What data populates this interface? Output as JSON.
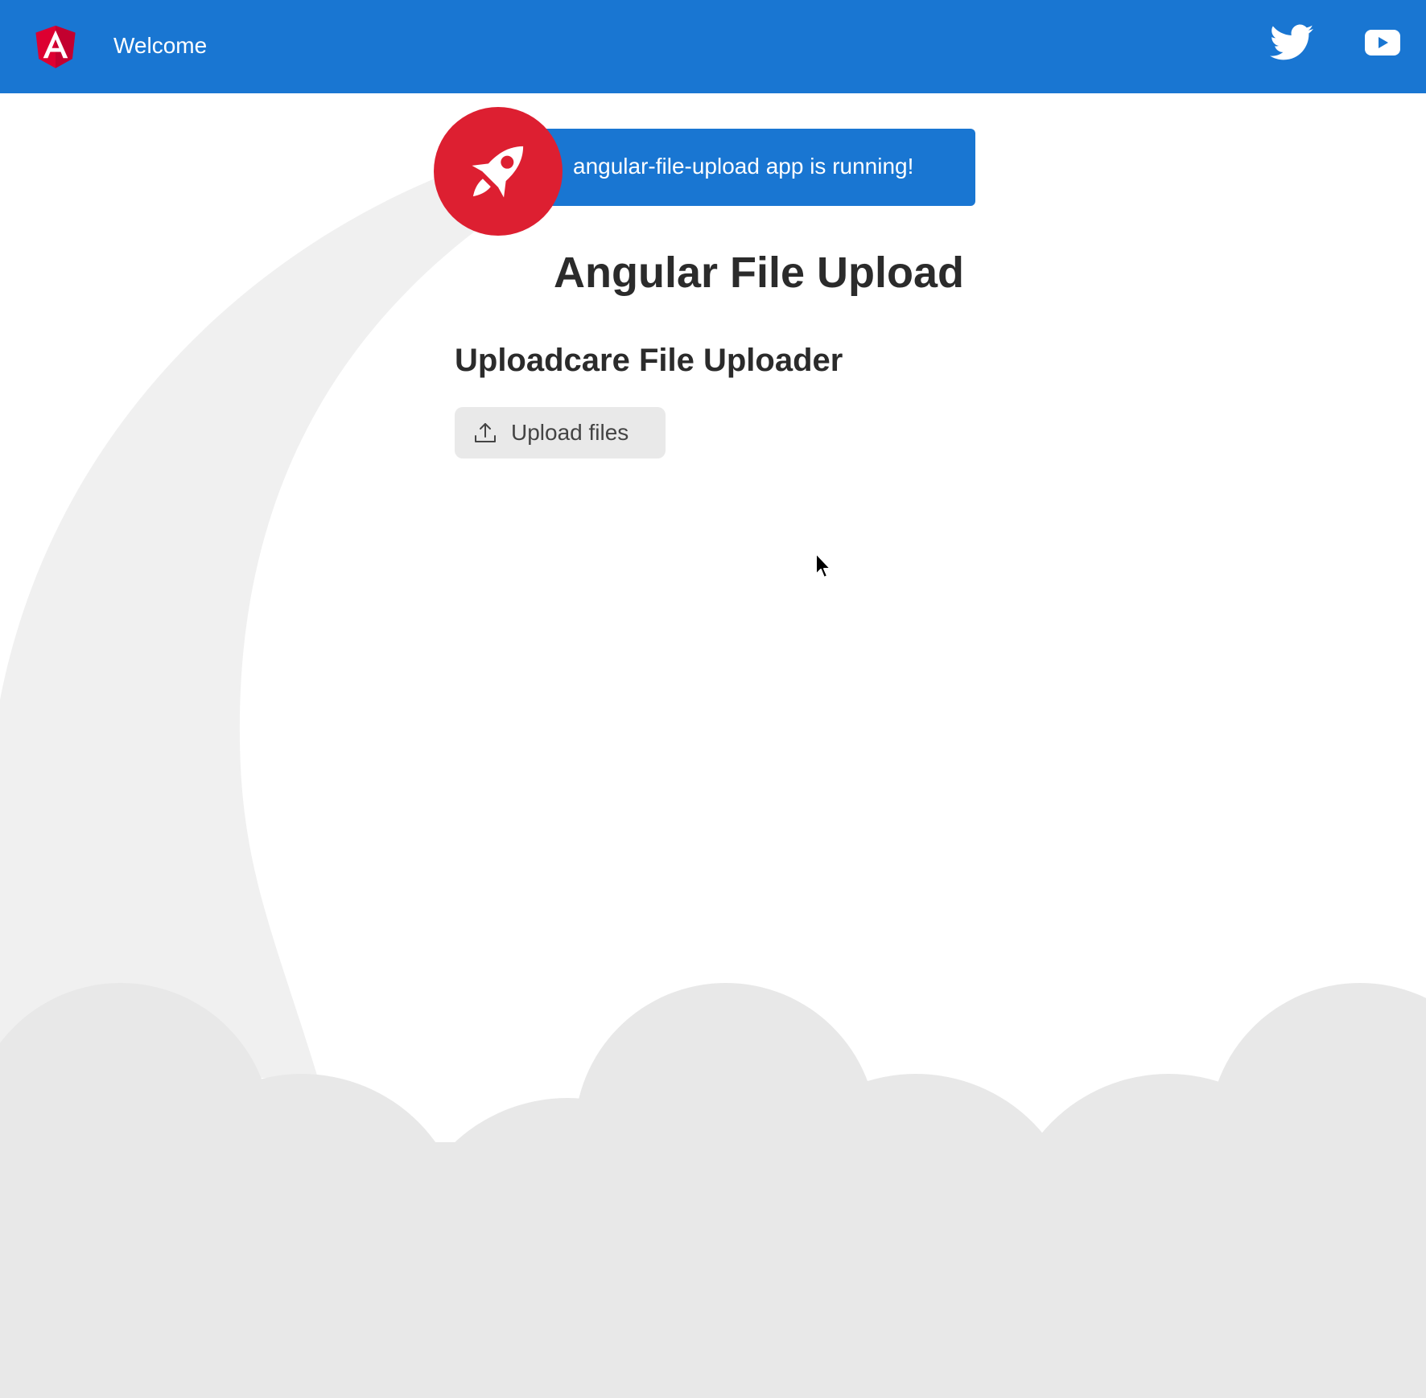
{
  "toolbar": {
    "title": "Welcome",
    "background_color": "#1976d2",
    "logo_icon": "angular-logo-icon",
    "links": [
      {
        "icon": "twitter-icon"
      },
      {
        "icon": "youtube-icon"
      }
    ]
  },
  "card": {
    "icon": "rocket-icon",
    "text": "angular-file-upload app is running!",
    "rocket_color": "#dd1f31"
  },
  "main": {
    "title": "Angular File Upload",
    "subtitle": "Uploadcare File Uploader",
    "upload_button": {
      "label": "Upload files",
      "icon": "upload-icon"
    }
  },
  "decor": {
    "trail_color": "#f0f0f0",
    "cloud_color": "#e8e8e8"
  }
}
